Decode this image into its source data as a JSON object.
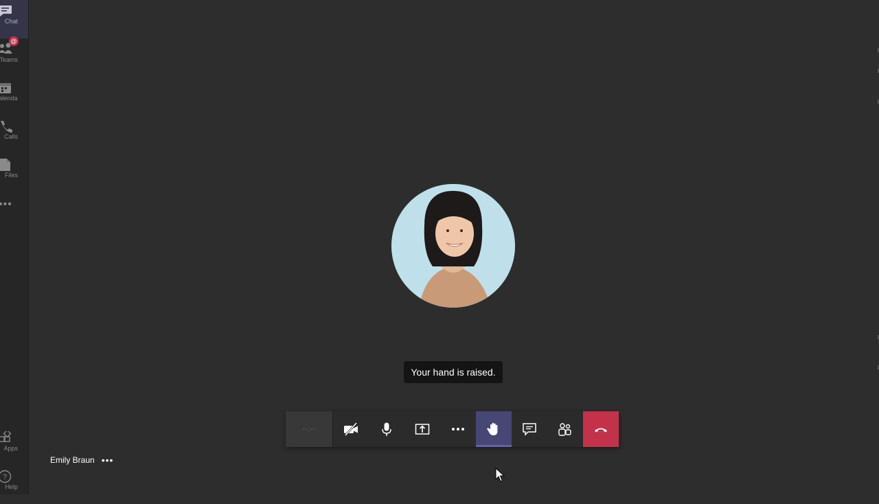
{
  "rail": {
    "items": [
      {
        "label": "Chat",
        "icon": "chat-icon"
      },
      {
        "label": "Teams",
        "icon": "teams-icon"
      },
      {
        "label": "Calendar",
        "icon": "calendar-icon"
      },
      {
        "label": "Calls",
        "icon": "calls-icon"
      },
      {
        "label": "Files",
        "icon": "files-icon"
      },
      {
        "label": "Apps",
        "icon": "apps-icon"
      },
      {
        "label": "Help",
        "icon": "help-icon"
      }
    ],
    "teams_badge": "@",
    "more": "•••"
  },
  "call": {
    "hand_raised_message": "Your hand is raised.",
    "timer_placeholder": "--:--",
    "toolbar": [
      {
        "name": "camera-off-button",
        "icon": "camera-off-icon"
      },
      {
        "name": "microphone-button",
        "icon": "microphone-icon"
      },
      {
        "name": "share-screen-button",
        "icon": "share-icon"
      },
      {
        "name": "more-actions-button",
        "icon": "more-icon"
      },
      {
        "name": "raise-hand-button",
        "icon": "hand-icon",
        "active": true
      },
      {
        "name": "chat-button",
        "icon": "chat-bubble-icon"
      },
      {
        "name": "participants-button",
        "icon": "people-icon"
      },
      {
        "name": "hang-up-button",
        "icon": "hang-up-icon"
      }
    ]
  },
  "participant": {
    "name": "Emily Braun",
    "more": "•••"
  },
  "colors": {
    "stage_bg": "#2d2d2d",
    "rail_bg": "#262626",
    "raised_hand": "#464775",
    "hang_up": "#c4314b"
  }
}
